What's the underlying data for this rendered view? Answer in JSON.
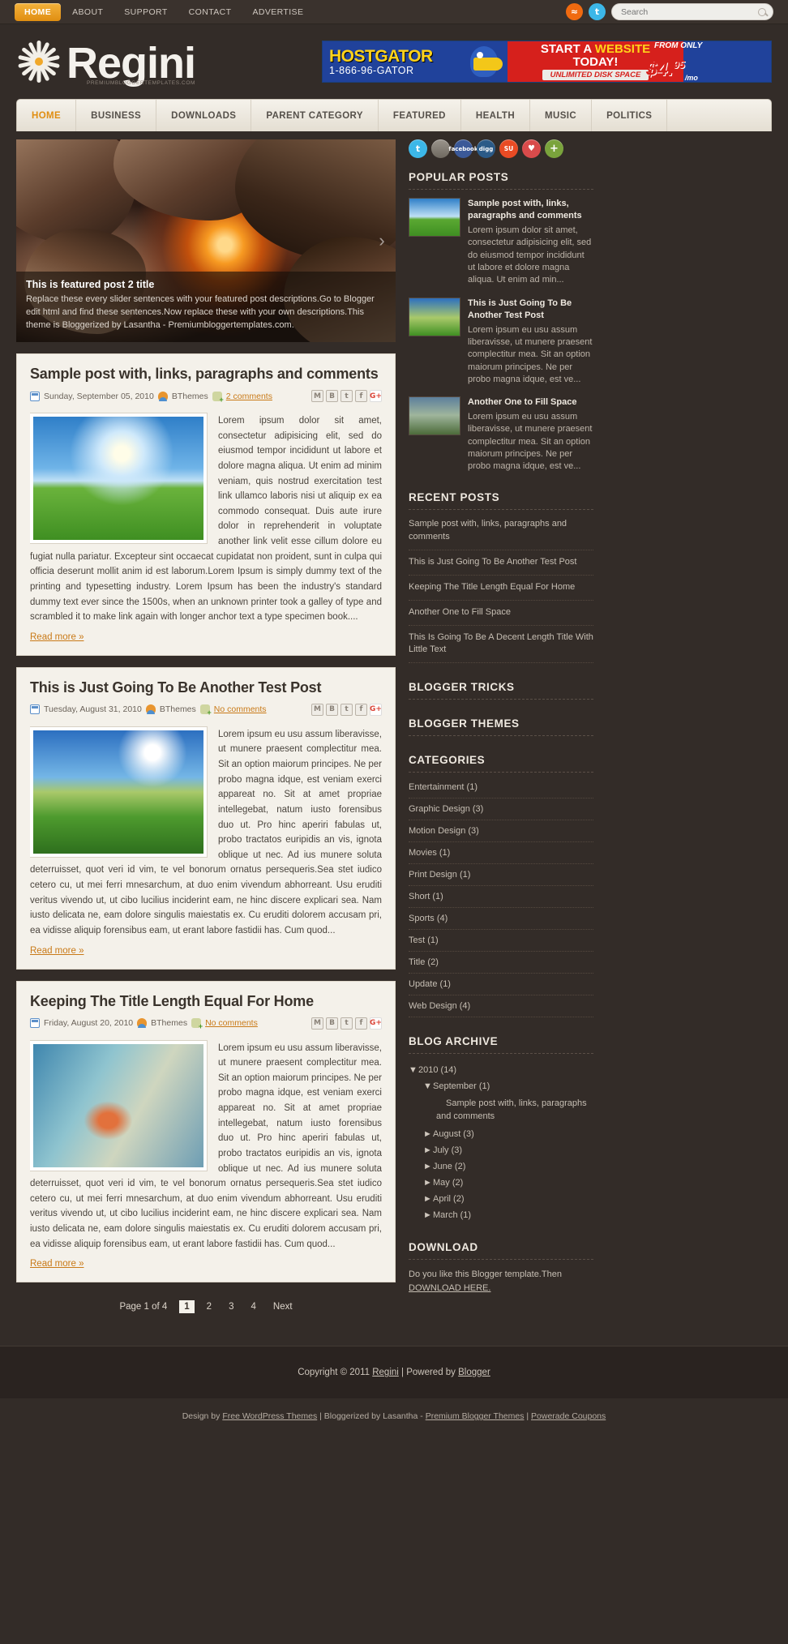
{
  "topbar": {
    "nav": [
      {
        "label": "HOME",
        "active": true
      },
      {
        "label": "ABOUT",
        "active": false
      },
      {
        "label": "SUPPORT",
        "active": false
      },
      {
        "label": "CONTACT",
        "active": false
      },
      {
        "label": "ADVERTISE",
        "active": false
      }
    ],
    "rss_icon": "rss-icon",
    "twitter_icon": "twitter-icon",
    "search_placeholder": "Search",
    "search_value": ""
  },
  "brand": {
    "name": "Regini",
    "tagline": "PREMIUMBLOGGERTEMPLATES.COM"
  },
  "ad": {
    "name": "HOSTGATOR",
    "phone": "1-866-96-GATOR",
    "headline_1": "START A ",
    "headline_em": "WEBSITE",
    "headline_2": "TODAY!",
    "sub": "UNLIMITED DISK SPACE",
    "from": "FROM ONLY",
    "price_dollar": "$4.",
    "price_cents": "95",
    "per": "/mo"
  },
  "mainnav": [
    {
      "label": "HOME",
      "active": true
    },
    {
      "label": "BUSINESS",
      "active": false
    },
    {
      "label": "DOWNLOADS",
      "active": false
    },
    {
      "label": "PARENT CATEGORY",
      "active": false
    },
    {
      "label": "FEATURED",
      "active": false
    },
    {
      "label": "HEALTH",
      "active": false
    },
    {
      "label": "MUSIC",
      "active": false
    },
    {
      "label": "POLITICS",
      "active": false
    }
  ],
  "slider": {
    "title": "This is featured post 2 title",
    "text": "Replace these every slider sentences with your featured post descriptions.Go to Blogger edit html and find these sentences.Now replace these with your own descriptions.This theme is Bloggerized by Lasantha - Premiumbloggertemplates.com.",
    "next_arrow": "›"
  },
  "posts": [
    {
      "title": "Sample post with, links, paragraphs and comments",
      "date": "Sunday, September 05, 2010",
      "author": "BThemes",
      "comments": "2 comments",
      "excerpt": "Lorem ipsum dolor sit amet, consectetur adipisicing elit, sed do eiusmod tempor incididunt ut labore et dolore magna aliqua. Ut enim ad minim veniam, quis nostrud exercitation test link ullamco laboris nisi ut aliquip ex ea commodo consequat. Duis aute irure dolor in reprehenderit in voluptate another link velit esse cillum dolore eu fugiat nulla pariatur. Excepteur sint occaecat cupidatat non proident, sunt in culpa qui officia deserunt mollit anim id est laborum.Lorem Ipsum is simply dummy text of the printing and typesetting industry. Lorem Ipsum has been the industry's standard dummy text ever since the 1500s, when an unknown printer took a galley of type and scrambled it to make link again with longer anchor text a type specimen book....",
      "read_more": "Read more »",
      "thumb": "t1"
    },
    {
      "title": "This is Just Going To Be Another Test Post",
      "date": "Tuesday, August 31, 2010",
      "author": "BThemes",
      "comments": "No comments",
      "excerpt": "Lorem ipsum eu usu assum liberavisse, ut munere praesent complectitur mea. Sit an option maiorum principes. Ne per probo magna idque, est veniam exerci appareat no. Sit at amet propriae intellegebat, natum iusto forensibus duo ut. Pro hinc aperiri fabulas ut, probo tractatos euripidis an vis, ignota oblique ut nec. Ad ius munere soluta deterruisset, quot veri id vim, te vel bonorum ornatus persequeris.Sea stet iudico cetero cu, ut mei ferri mnesarchum, at duo enim vivendum abhorreant. Usu eruditi veritus vivendo ut, ut cibo lucilius inciderint eam, ne hinc discere explicari sea. Nam iusto delicata ne, eam dolore singulis maiestatis ex. Cu eruditi dolorem accusam pri, ea vidisse aliquip forensibus eam, ut erant labore fastidii has. Cum quod...",
      "read_more": "Read more »",
      "thumb": "t2"
    },
    {
      "title": "Keeping The Title Length Equal For Home",
      "date": "Friday, August 20, 2010",
      "author": "BThemes",
      "comments": "No comments",
      "excerpt": "Lorem ipsum eu usu assum liberavisse, ut munere praesent complectitur mea. Sit an option maiorum principes. Ne per probo magna idque, est veniam exerci appareat no. Sit at amet propriae intellegebat, natum iusto forensibus duo ut. Pro hinc aperiri fabulas ut, probo tractatos euripidis an vis, ignota oblique ut nec. Ad ius munere soluta deterruisset, quot veri id vim, te vel bonorum ornatus persequeris.Sea stet iudico cetero cu, ut mei ferri mnesarchum, at duo enim vivendum abhorreant. Usu eruditi veritus vivendo ut, ut cibo lucilius inciderint eam, ne hinc discere explicari sea. Nam iusto delicata ne, eam dolore singulis maiestatis ex. Cu eruditi dolorem accusam pri, ea vidisse aliquip forensibus eam, ut erant labore fastidii has. Cum quod...",
      "read_more": "Read more »",
      "thumb": "t3"
    }
  ],
  "share_icons": [
    "M",
    "B",
    "t",
    "f",
    "G+"
  ],
  "pager": {
    "label": "Page 1 of 4",
    "pages": [
      "1",
      "2",
      "3",
      "4"
    ],
    "current": "1",
    "next": "Next"
  },
  "sidebar": {
    "social": [
      {
        "name": "twitter-icon",
        "glyph": "t",
        "cls": "tw"
      },
      {
        "name": "delicious-icon",
        "glyph": "",
        "cls": "del"
      },
      {
        "name": "facebook-icon",
        "glyph": "facebook",
        "cls": "fb"
      },
      {
        "name": "digg-icon",
        "glyph": "digg",
        "cls": "digg"
      },
      {
        "name": "stumbleupon-icon",
        "glyph": "SU",
        "cls": "su"
      },
      {
        "name": "love-icon",
        "glyph": "♥",
        "cls": "love"
      },
      {
        "name": "more-icon",
        "glyph": "+",
        "cls": "plus"
      }
    ],
    "popular_title": "POPULAR POSTS",
    "popular": [
      {
        "title": "Sample post with, links, paragraphs and comments",
        "text": "Lorem ipsum dolor sit amet, consectetur adipisicing elit, sed do eiusmod tempor incididunt ut labore et dolore magna aliqua. Ut enim ad min...",
        "img": "a"
      },
      {
        "title": "This is Just Going To Be Another Test Post",
        "text": "Lorem ipsum eu usu assum liberavisse, ut munere praesent complectitur mea. Sit an option maiorum principes. Ne per probo magna idque, est ve...",
        "img": "b"
      },
      {
        "title": "Another One to Fill Space",
        "text": "Lorem ipsum eu usu assum liberavisse, ut munere praesent complectitur mea. Sit an option maiorum principes. Ne per probo magna idque, est ve...",
        "img": "c"
      }
    ],
    "recent_title": "RECENT POSTS",
    "recent": [
      "Sample post with, links, paragraphs and comments",
      "This is Just Going To Be Another Test Post",
      "Keeping The Title Length Equal For Home",
      "Another One to Fill Space",
      "This Is Going To Be A Decent Length Title With Little Text"
    ],
    "tricks_title": "BLOGGER TRICKS",
    "themes_title": "BLOGGER THEMES",
    "categories_title": "CATEGORIES",
    "categories": [
      "Entertainment (1)",
      "Graphic Design (3)",
      "Motion Design (3)",
      "Movies (1)",
      "Print Design (1)",
      "Short (1)",
      "Sports (4)",
      "Test (1)",
      "Title (2)",
      "Update (1)",
      "Web Design (4)"
    ],
    "archive_title": "BLOG ARCHIVE",
    "archive": [
      {
        "level": 1,
        "tri": "▼",
        "label": "2010 (14)"
      },
      {
        "level": 2,
        "tri": "▼",
        "label": "September (1)"
      },
      {
        "level": 3,
        "tri": "",
        "label": "Sample post with, links, paragraphs and comments"
      },
      {
        "level": 2,
        "tri": "►",
        "label": "August (3)"
      },
      {
        "level": 2,
        "tri": "►",
        "label": "July (3)"
      },
      {
        "level": 2,
        "tri": "►",
        "label": "June (2)"
      },
      {
        "level": 2,
        "tri": "►",
        "label": "May (2)"
      },
      {
        "level": 2,
        "tri": "►",
        "label": "April (2)"
      },
      {
        "level": 2,
        "tri": "►",
        "label": "March (1)"
      }
    ],
    "download_title": "DOWNLOAD",
    "download_text": "Do you like this Blogger template.Then ",
    "download_link": "DOWNLOAD HERE."
  },
  "footer": {
    "copyright_pre": "Copyright © 2011 ",
    "site": "Regini",
    "mid": " | Powered by ",
    "blogger": "Blogger",
    "sub_pre": "Design by ",
    "sub_a": "Free WordPress Themes",
    "sub_mid": " | Bloggerized by Lasantha - ",
    "sub_b": "Premium Blogger Themes",
    "sub_mid2": " | ",
    "sub_c": "Powerade Coupons"
  }
}
